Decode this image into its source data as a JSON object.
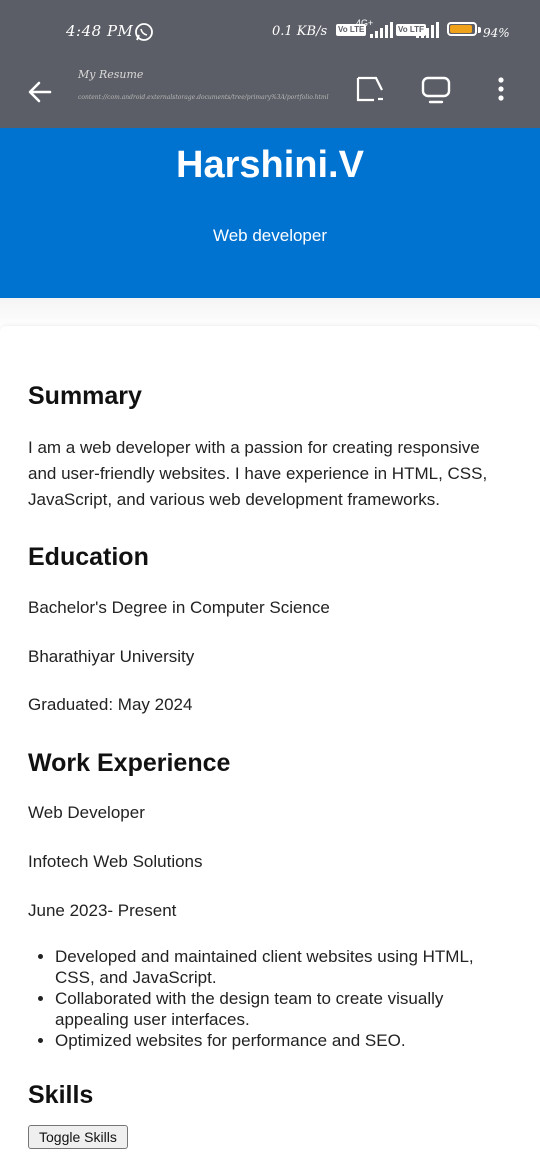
{
  "status_bar": {
    "time": "4:48 PM",
    "net_speed": "0.1 KB/s",
    "volte1": "Vo LTE",
    "network_label": "4G+",
    "volte2": "Vo LTE",
    "battery_percent": "94%",
    "battery_level": 0.94
  },
  "app_bar": {
    "title": "My Resume",
    "url": "content://com.android.externalstorage.documents/tree/primary%3A/portfolio.html",
    "icons": [
      "back-arrow-icon",
      "cast-icon",
      "tablet-icon",
      "more-vert-icon"
    ]
  },
  "header": {
    "name": "Harshini.V",
    "role": "Web developer",
    "color": "#0073d1"
  },
  "summary": {
    "heading": "Summary",
    "line1": "I am a web developer with a passion for creating responsive",
    "line2": "and user-friendly websites. I have experience in HTML, CSS,",
    "line3": "JavaScript, and various web development frameworks."
  },
  "education": {
    "heading": "Education",
    "degree": "Bachelor's Degree in Computer Science",
    "university": "Bharathiyar University",
    "graduated": "Graduated: May 2024"
  },
  "work": {
    "heading": "Work Experience",
    "title": "Web Developer",
    "company": "Infotech Web Solutions",
    "period": "June 2023- Present",
    "bullets": [
      "Developed and maintained client websites using HTML, CSS, and JavaScript.",
      "Collaborated with the design team to create visually appealing user interfaces.",
      "Optimized websites for performance and SEO."
    ]
  },
  "skills": {
    "heading": "Skills",
    "toggle_label": "Toggle Skills"
  }
}
